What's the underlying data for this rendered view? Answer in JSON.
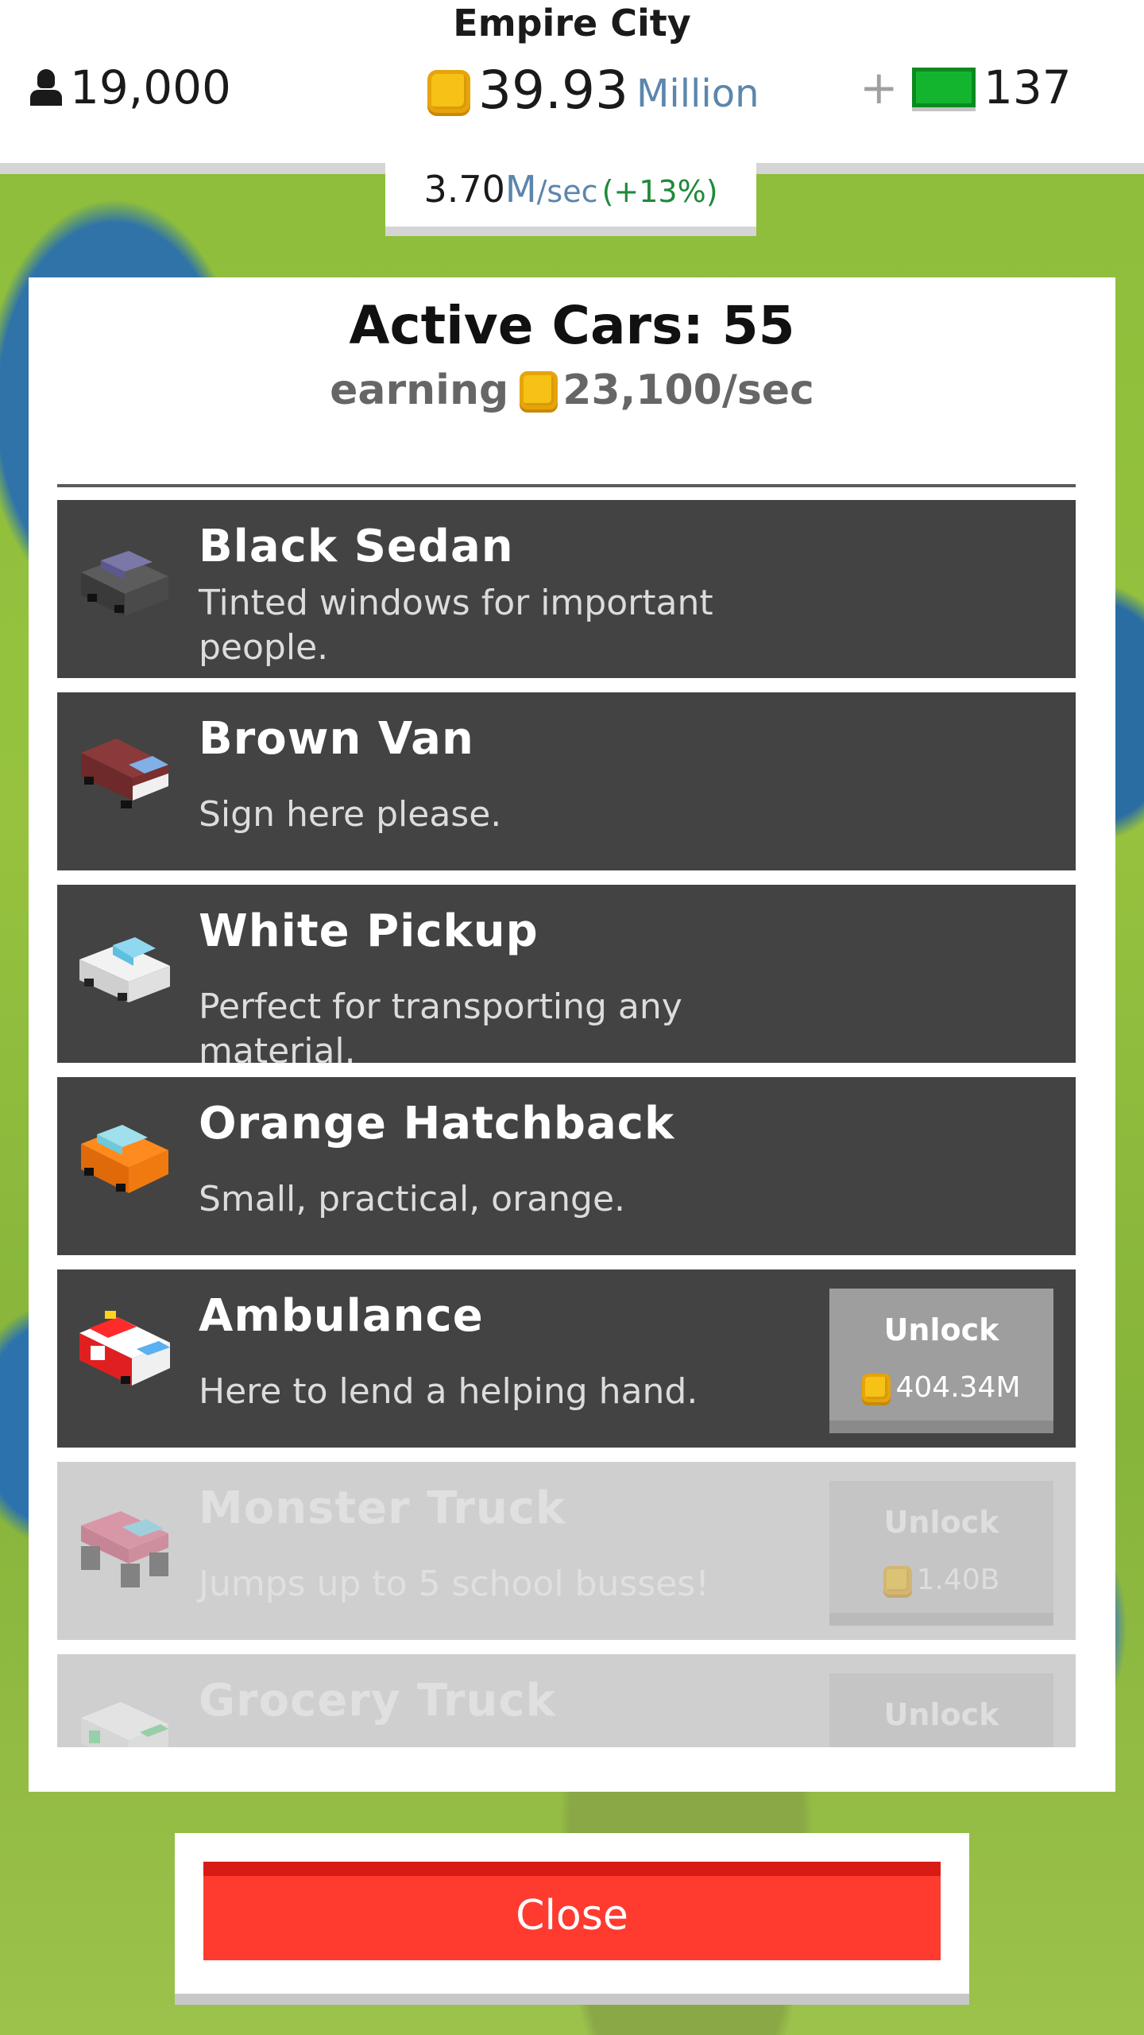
{
  "city": {
    "name": "Empire City"
  },
  "stats": {
    "population": "19,000",
    "money_value": "39.93",
    "money_unit": "Million",
    "plus": "+",
    "gems": "137"
  },
  "rate": {
    "value": "3.70",
    "unit": "M",
    "per": "/sec",
    "bonus": "(+13%)"
  },
  "panel": {
    "title": "Active Cars: 55",
    "earning_label": "earning",
    "earning_value": "23,100/sec"
  },
  "cars": [
    {
      "name": "Black Sedan",
      "desc": "Tinted windows for important people.",
      "icon": "black-sedan-icon"
    },
    {
      "name": "Brown Van",
      "desc": "Sign here please.",
      "icon": "brown-van-icon"
    },
    {
      "name": "White Pickup",
      "desc": "Perfect for transporting any material.",
      "icon": "white-pickup-icon"
    },
    {
      "name": "Orange Hatchback",
      "desc": "Small, practical, orange.",
      "icon": "orange-hatchback-icon"
    },
    {
      "name": "Ambulance",
      "desc": "Here to lend a helping hand.",
      "icon": "ambulance-icon",
      "unlock_label": "Unlock",
      "price": "404.34M"
    },
    {
      "name": "Monster Truck",
      "desc": "Jumps up to 5 school busses!",
      "icon": "monster-truck-icon",
      "unlock_label": "Unlock",
      "price": "1.40B"
    },
    {
      "name": "Grocery Truck",
      "desc": "",
      "icon": "grocery-truck-icon",
      "unlock_label": "Unlock",
      "price": ""
    }
  ],
  "close_label": "Close",
  "colors": {
    "accent_red": "#ff3b30",
    "coin": "#f6c215",
    "gem": "#14b52e",
    "row_bg": "#434343"
  }
}
